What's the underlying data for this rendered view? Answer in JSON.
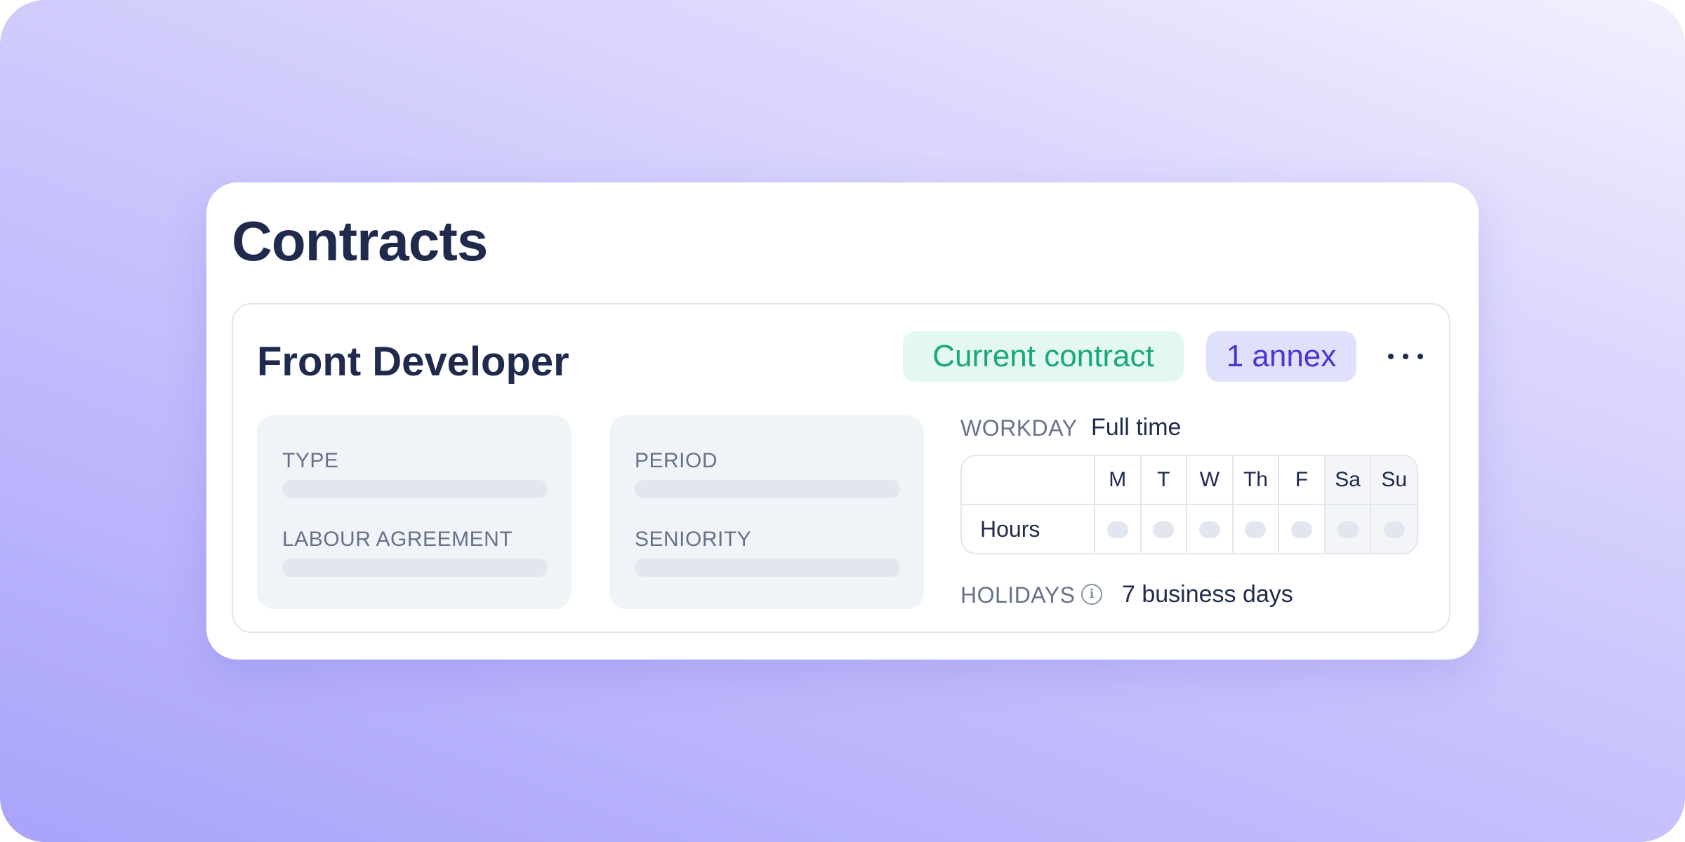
{
  "page": {
    "title": "Contracts"
  },
  "contract": {
    "title": "Front Developer",
    "status_badge": "Current contract",
    "annex_badge": "1 annex",
    "menu_icon": "more-horizontal-icon",
    "fields_left": [
      {
        "label": "TYPE",
        "value": ""
      },
      {
        "label": "LABOUR AGREEMENT",
        "value": ""
      }
    ],
    "fields_right": [
      {
        "label": "PERIOD",
        "value": ""
      },
      {
        "label": "SENIORITY",
        "value": ""
      }
    ],
    "workday": {
      "label": "WORKDAY",
      "value": "Full time"
    },
    "schedule": {
      "days": [
        "M",
        "T",
        "W",
        "Th",
        "F",
        "Sa",
        "Su"
      ],
      "row_label": "Hours"
    },
    "holidays": {
      "label": "HOLIDAYS",
      "icon": "info-icon",
      "value": "7 business days"
    }
  },
  "colors": {
    "heading": "#1f2a4d",
    "muted_label": "#67728a",
    "status_badge_bg": "#e2f8f1",
    "status_badge_text": "#1aa77a",
    "annex_badge_bg": "#dfe0fb",
    "annex_badge_text": "#4a36d3",
    "background_gradient_start": "#a9a3fb",
    "background_gradient_end": "#f2f0fe"
  }
}
